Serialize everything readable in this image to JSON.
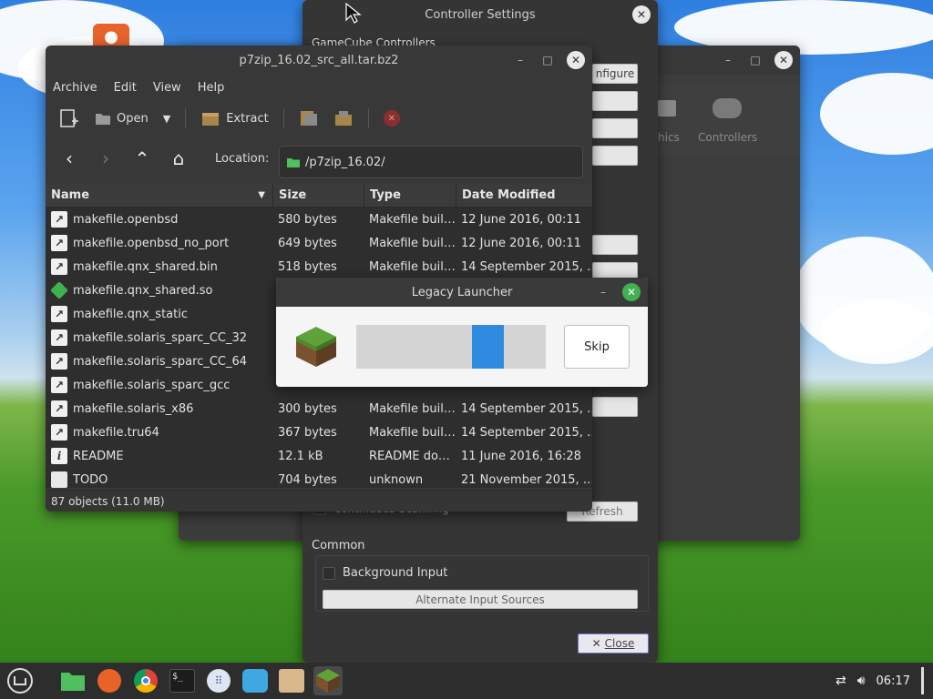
{
  "back_window": {
    "tools": [
      "Graphics",
      "Controllers"
    ],
    "tool_partial": "hics"
  },
  "controller_settings": {
    "title": "Controller Settings",
    "section_gamecube": "GameCube Controllers",
    "configure_label": "Configure",
    "configure_partial": "nfigure",
    "continuous_scanning": "Continuous Scanning",
    "refresh": "Refresh",
    "section_common": "Common",
    "background_input": "Background Input",
    "alternate_sources": "Alternate Input Sources",
    "close": "Close"
  },
  "archive": {
    "title": "p7zip_16.02_src_all.tar.bz2",
    "menu": [
      "Archive",
      "Edit",
      "View",
      "Help"
    ],
    "toolbar": {
      "open": "Open",
      "extract": "Extract"
    },
    "location_label": "Location:",
    "location_value": "/p7zip_16.02/",
    "columns": {
      "name": "Name",
      "size": "Size",
      "type": "Type",
      "date": "Date Modified"
    },
    "files": [
      {
        "name": "makefile.openbsd",
        "size": "580 bytes",
        "type": "Makefile buil…",
        "date": "12 June 2016, 00:11",
        "icon": "link"
      },
      {
        "name": "makefile.openbsd_no_port",
        "size": "649 bytes",
        "type": "Makefile buil…",
        "date": "12 June 2016, 00:11",
        "icon": "link"
      },
      {
        "name": "makefile.qnx_shared.bin",
        "size": "518 bytes",
        "type": "Makefile buil…",
        "date": "14 September 2015, …",
        "icon": "link"
      },
      {
        "name": "makefile.qnx_shared.so",
        "size": "",
        "type": "",
        "date": "",
        "icon": "diamond"
      },
      {
        "name": "makefile.qnx_static",
        "size": "",
        "type": "",
        "date": "",
        "icon": "link"
      },
      {
        "name": "makefile.solaris_sparc_CC_32",
        "size": "",
        "type": "",
        "date": "",
        "icon": "link"
      },
      {
        "name": "makefile.solaris_sparc_CC_64",
        "size": "",
        "type": "",
        "date": "",
        "icon": "link"
      },
      {
        "name": "makefile.solaris_sparc_gcc",
        "size": "",
        "type": "",
        "date": "",
        "icon": "link"
      },
      {
        "name": "makefile.solaris_x86",
        "size": "300 bytes",
        "type": "Makefile buil…",
        "date": "14 September 2015, …",
        "icon": "link"
      },
      {
        "name": "makefile.tru64",
        "size": "367 bytes",
        "type": "Makefile buil…",
        "date": "14 September 2015, …",
        "icon": "link"
      },
      {
        "name": "README",
        "size": "12.1 kB",
        "type": "README do…",
        "date": "11 June 2016, 16:28",
        "icon": "info"
      },
      {
        "name": "TODO",
        "size": "704 bytes",
        "type": "unknown",
        "date": "21 November 2015, …",
        "icon": "blank"
      }
    ],
    "status": "87 objects (11.0 MB)"
  },
  "launcher": {
    "title": "Legacy Launcher",
    "skip": "Skip"
  },
  "taskbar": {
    "clock": "06:17"
  }
}
